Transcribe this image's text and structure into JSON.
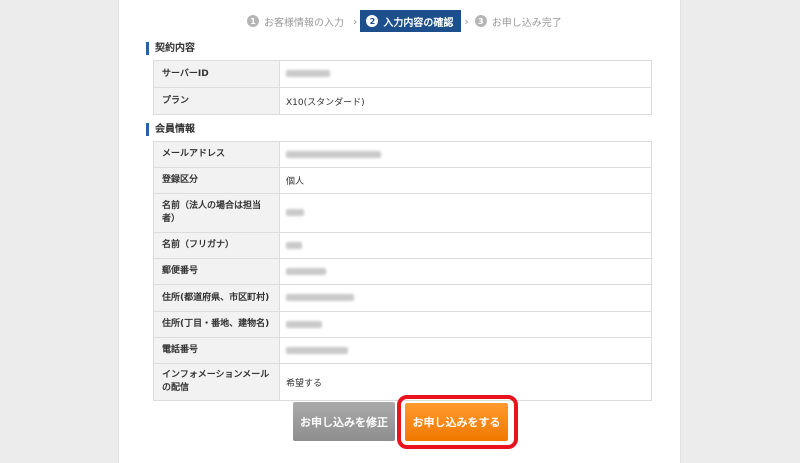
{
  "steps": [
    {
      "num": "1",
      "label": "お客様情報の入力"
    },
    {
      "num": "2",
      "label": "入力内容の確認"
    },
    {
      "num": "3",
      "label": "お申し込み完了"
    }
  ],
  "contract": {
    "title": "契約内容",
    "rows": [
      {
        "label": "サーバーID",
        "value": ""
      },
      {
        "label": "プラン",
        "value": "X10(スタンダード)"
      }
    ]
  },
  "member": {
    "title": "会員情報",
    "rows": [
      {
        "label": "メールアドレス",
        "value": ""
      },
      {
        "label": "登録区分",
        "value": "個人"
      },
      {
        "label": "名前（法人の場合は担当者）",
        "value": ""
      },
      {
        "label": "名前（フリガナ）",
        "value": ""
      },
      {
        "label": "郵便番号",
        "value": ""
      },
      {
        "label": "住所(都道府県、市区町村)",
        "value": ""
      },
      {
        "label": "住所(丁目・番地、建物名)",
        "value": ""
      },
      {
        "label": "電話番号",
        "value": ""
      },
      {
        "label": "インフォメーションメールの配信",
        "value": "希望する"
      }
    ]
  },
  "buttons": {
    "modify": "お申し込みを修正",
    "submit": "お申し込みをする"
  },
  "colors": {
    "active_step": "#1d4f8c",
    "submit": "#f07800",
    "highlight": "#e8131c"
  }
}
